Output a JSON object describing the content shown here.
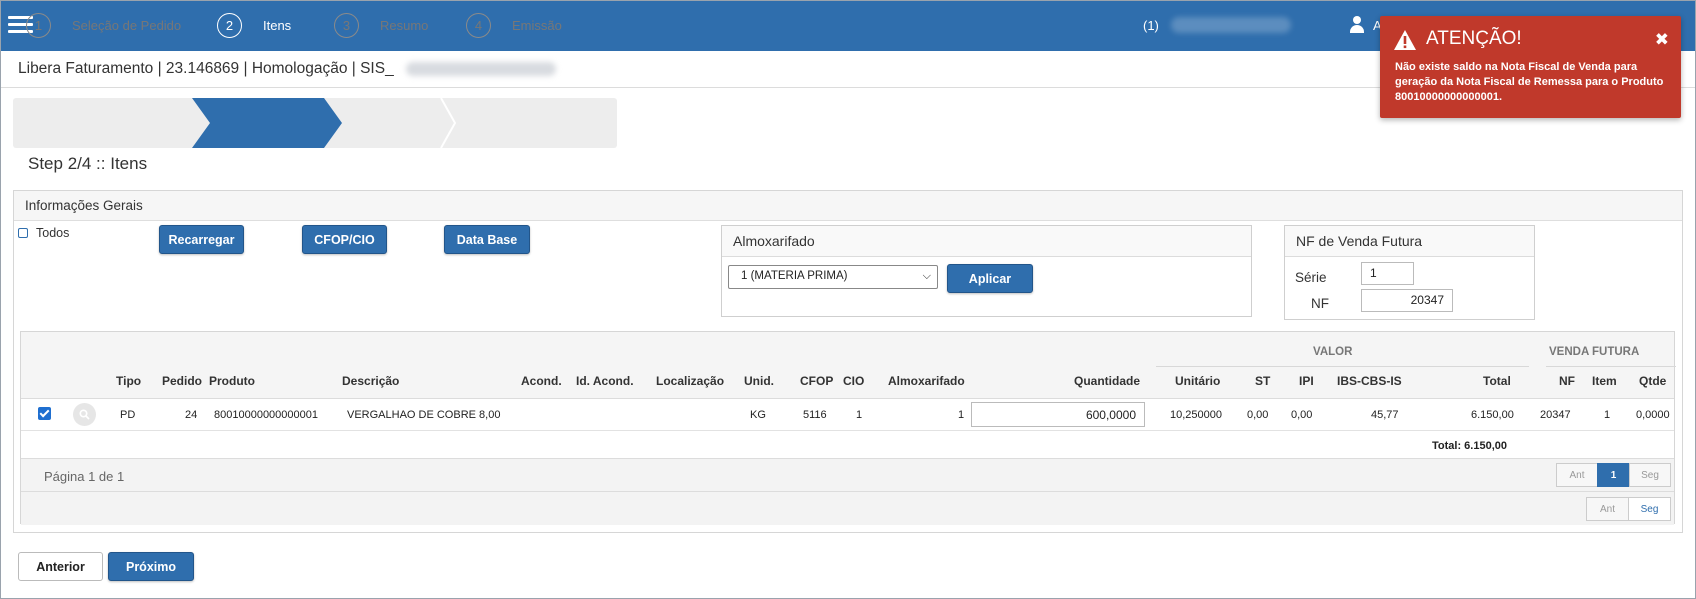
{
  "topbar": {
    "count_label": "(1)",
    "user_initial": "A"
  },
  "header": {
    "subtitle": "Libera Faturamento | 23.146869 | Homologação | SIS_"
  },
  "wizard": {
    "steps": [
      {
        "number": "1",
        "label": "Seleção de Pedido"
      },
      {
        "number": "2",
        "label": "Itens"
      },
      {
        "number": "3",
        "label": "Resumo"
      },
      {
        "number": "4",
        "label": "Emissão"
      }
    ],
    "active_step": 2,
    "step_title": "Step 2/4 :: Itens"
  },
  "panel": {
    "title": "Informações Gerais",
    "todos_label": "Todos",
    "buttons": {
      "recarregar": "Recarregar",
      "cfop": "CFOP/CIO",
      "data_base": "Data Base"
    }
  },
  "almoxarifado": {
    "title": "Almoxarifado",
    "selected": "1 (MATERIA PRIMA)",
    "apply_label": "Aplicar"
  },
  "nf_venda_futura": {
    "title": "NF de Venda Futura",
    "serie_label": "Série",
    "serie_value": "1",
    "nf_label": "NF",
    "nf_value": "20347"
  },
  "grid": {
    "groups": {
      "valor": "VALOR",
      "venda_futura": "VENDA FUTURA"
    },
    "columns": {
      "tipo": "Tipo",
      "pedido": "Pedido",
      "produto": "Produto",
      "descricao": "Descrição",
      "acond": "Acond.",
      "id_acond": "Id. Acond.",
      "localizacao": "Localização",
      "unid": "Unid.",
      "cfop": "CFOP",
      "cio": "CIO",
      "almoxarifado": "Almoxarifado",
      "quantidade": "Quantidade",
      "unitario": "Unitário",
      "st": "ST",
      "ipi": "IPI",
      "ibs": "IBS-CBS-IS",
      "total": "Total",
      "nf": "NF",
      "item": "Item",
      "qtde": "Qtde"
    },
    "row": {
      "tipo": "PD",
      "pedido": "24",
      "produto": "80010000000000001",
      "descricao": "VERGALHAO DE COBRE 8,00",
      "unid": "KG",
      "cfop": "5116",
      "cio": "1",
      "almoxarifado": "1",
      "quantidade": "600,0000",
      "unitario": "10,250000",
      "st": "0,00",
      "ipi": "0,00",
      "ibs": "45,77",
      "total": "6.150,00",
      "nf": "20347",
      "item": "1",
      "qtde": "0,0000"
    },
    "total_label": "Total: 6.150,00",
    "pager": {
      "text": "Página 1 de 1",
      "prev": "Ant",
      "current": "1",
      "next": "Seg"
    }
  },
  "footer": {
    "anterior": "Anterior",
    "proximo": "Próximo"
  },
  "alert": {
    "title": "ATENÇÃO!",
    "message": "Não existe saldo na Nota Fiscal de Venda para geração da Nota Fiscal de Remessa para o Produto 80010000000000001.",
    "color": "#c0392b"
  },
  "colors": {
    "brand": "#2f6ead"
  }
}
